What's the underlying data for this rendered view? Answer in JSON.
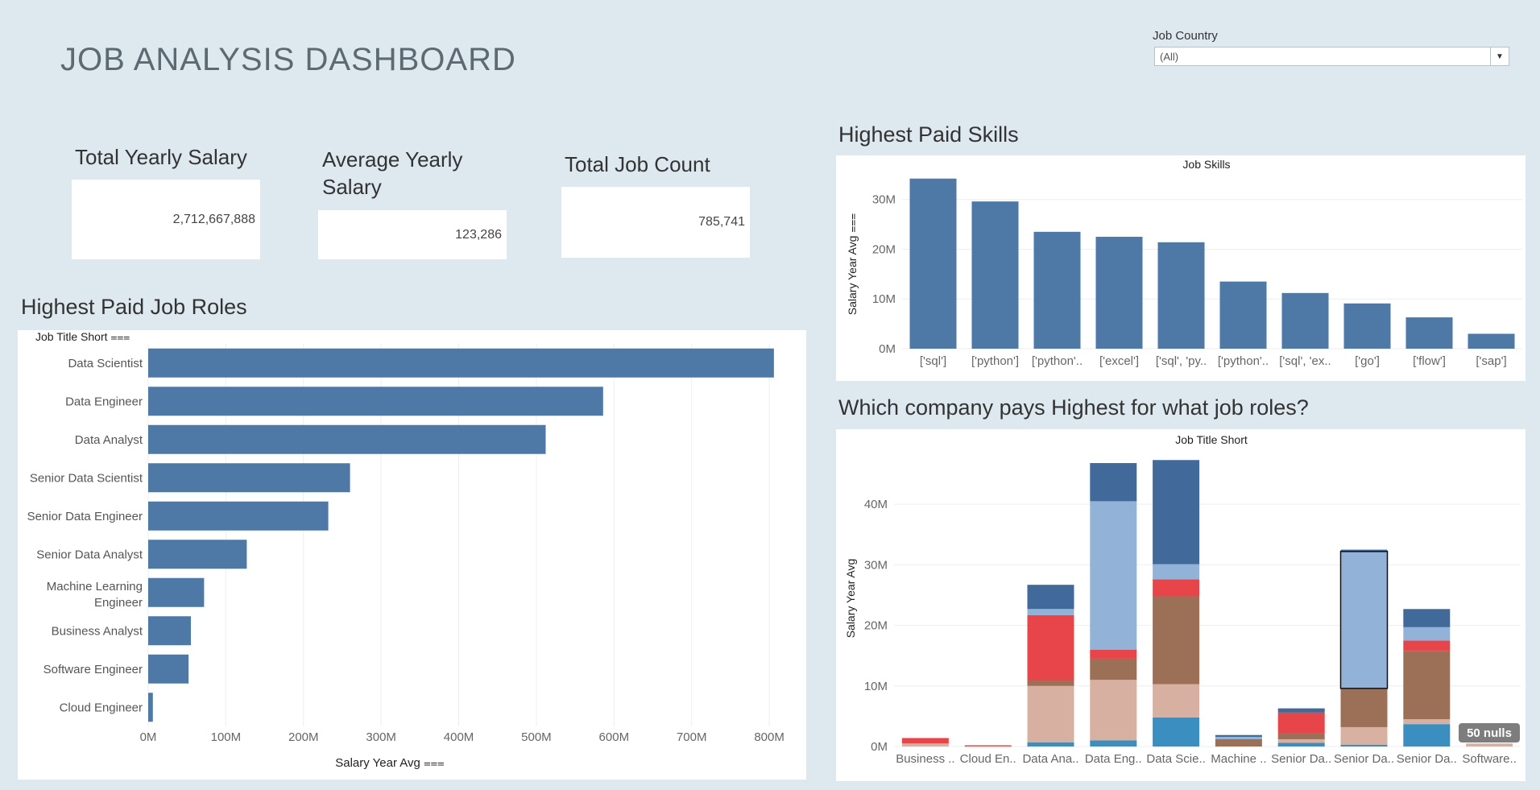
{
  "title": "JOB ANALYSIS DASHBOARD",
  "filter": {
    "label": "Job Country",
    "value": "(All)"
  },
  "kpis": [
    {
      "title": "Total Yearly Salary",
      "value": "2,712,667,888"
    },
    {
      "title": "Average Yearly Salary",
      "value": "123,286"
    },
    {
      "title": "Total Job Count",
      "value": "785,741"
    }
  ],
  "sections": {
    "roles": "Highest Paid Job Roles",
    "skills": "Highest Paid Skills",
    "company": "Which company pays Highest for what job roles?"
  },
  "colors": {
    "bar": "#4e79a7",
    "dark_blue": "#416a9a",
    "light_blue": "#93b2d8",
    "red": "#e8454a",
    "brown": "#9b7057",
    "tan": "#d7b0a1",
    "teal": "#3b8fc0",
    "background": "#dde9ef"
  },
  "chart_data": [
    {
      "type": "bar",
      "orientation": "horizontal",
      "row_header": "Job Title Short",
      "xlabel": "Salary Year Avg",
      "xlim": [
        0,
        830
      ],
      "x_ticks": [
        0,
        100,
        200,
        300,
        400,
        500,
        600,
        700,
        800
      ],
      "x_tick_labels": [
        "0M",
        "100M",
        "200M",
        "300M",
        "400M",
        "500M",
        "600M",
        "700M",
        "800M"
      ],
      "categories": [
        "Data Scientist",
        "Data Engineer",
        "Data Analyst",
        "Senior Data Scientist",
        "Senior Data Engineer",
        "Senior Data Analyst",
        "Machine Learning Engineer",
        "Business Analyst",
        "Software Engineer",
        "Cloud Engineer"
      ],
      "values": [
        806,
        586,
        512,
        260,
        232,
        127,
        72,
        55,
        52,
        6
      ]
    },
    {
      "type": "bar",
      "title": "Job Skills",
      "ylabel": "Salary Year Avg",
      "ylim": [
        0,
        34
      ],
      "y_ticks": [
        0,
        10,
        20,
        30
      ],
      "y_tick_labels": [
        "0M",
        "10M",
        "20M",
        "30M"
      ],
      "categories": [
        "['sql']",
        "['python']",
        "['python'..",
        "['excel']",
        "['sql', 'py..",
        "['python'..",
        "['sql', 'ex..",
        "['go']",
        "['flow']",
        "['sap']"
      ],
      "values": [
        34.2,
        29.6,
        23.5,
        22.5,
        21.4,
        13.5,
        11.2,
        9.1,
        6.3,
        3.0
      ]
    },
    {
      "type": "bar",
      "stacked": true,
      "title": "Job Title Short",
      "ylabel": "Salary Year Avg",
      "ylim": [
        0,
        48
      ],
      "y_ticks": [
        0,
        10,
        20,
        30,
        40
      ],
      "y_tick_labels": [
        "0M",
        "10M",
        "20M",
        "30M",
        "40M"
      ],
      "categories": [
        "Business ..",
        "Cloud En..",
        "Data Ana..",
        "Data Eng..",
        "Data Scie..",
        "Machine ..",
        "Senior Da..",
        "Senior Da..",
        "Senior Da..",
        "Software.."
      ],
      "stacks": [
        [
          {
            "color": "tan",
            "value": 0.5
          },
          {
            "color": "red",
            "value": 0.9
          }
        ],
        [
          {
            "color": "red",
            "value": 0.2
          }
        ],
        [
          {
            "color": "teal",
            "value": 0.7
          },
          {
            "color": "tan",
            "value": 9.3
          },
          {
            "color": "brown",
            "value": 0.9
          },
          {
            "color": "red",
            "value": 10.8
          },
          {
            "color": "light_blue",
            "value": 1.0
          },
          {
            "color": "dark_blue",
            "value": 4.0
          }
        ],
        [
          {
            "color": "teal",
            "value": 1.0
          },
          {
            "color": "tan",
            "value": 10.0
          },
          {
            "color": "brown",
            "value": 3.5
          },
          {
            "color": "red",
            "value": 1.5
          },
          {
            "color": "light_blue",
            "value": 24.5
          },
          {
            "color": "dark_blue",
            "value": 6.3
          }
        ],
        [
          {
            "color": "teal",
            "value": 4.8
          },
          {
            "color": "tan",
            "value": 5.5
          },
          {
            "color": "brown",
            "value": 14.5
          },
          {
            "color": "red",
            "value": 2.8
          },
          {
            "color": "light_blue",
            "value": 2.5
          },
          {
            "color": "dark_blue",
            "value": 17.2
          }
        ],
        [
          {
            "color": "brown",
            "value": 1.2
          },
          {
            "color": "light_blue",
            "value": 0.4
          },
          {
            "color": "dark_blue",
            "value": 0.3
          }
        ],
        [
          {
            "color": "teal",
            "value": 0.6
          },
          {
            "color": "tan",
            "value": 0.6
          },
          {
            "color": "brown",
            "value": 1.0
          },
          {
            "color": "red",
            "value": 3.4
          },
          {
            "color": "dark_blue",
            "value": 0.7
          }
        ],
        [
          {
            "color": "teal",
            "value": 0.3
          },
          {
            "color": "tan",
            "value": 2.9
          },
          {
            "color": "brown",
            "value": 6.4
          },
          {
            "color": "light_blue",
            "value": 22.6
          },
          {
            "color": "dark_blue",
            "value": 0.3
          }
        ],
        [
          {
            "color": "teal",
            "value": 3.7
          },
          {
            "color": "tan",
            "value": 0.8
          },
          {
            "color": "brown",
            "value": 11.3
          },
          {
            "color": "red",
            "value": 1.7
          },
          {
            "color": "light_blue",
            "value": 2.2
          },
          {
            "color": "dark_blue",
            "value": 3.0
          }
        ],
        [
          {
            "color": "tan",
            "value": 0.5
          }
        ]
      ],
      "highlighted_index": 7,
      "annotation": "50 nulls"
    }
  ]
}
